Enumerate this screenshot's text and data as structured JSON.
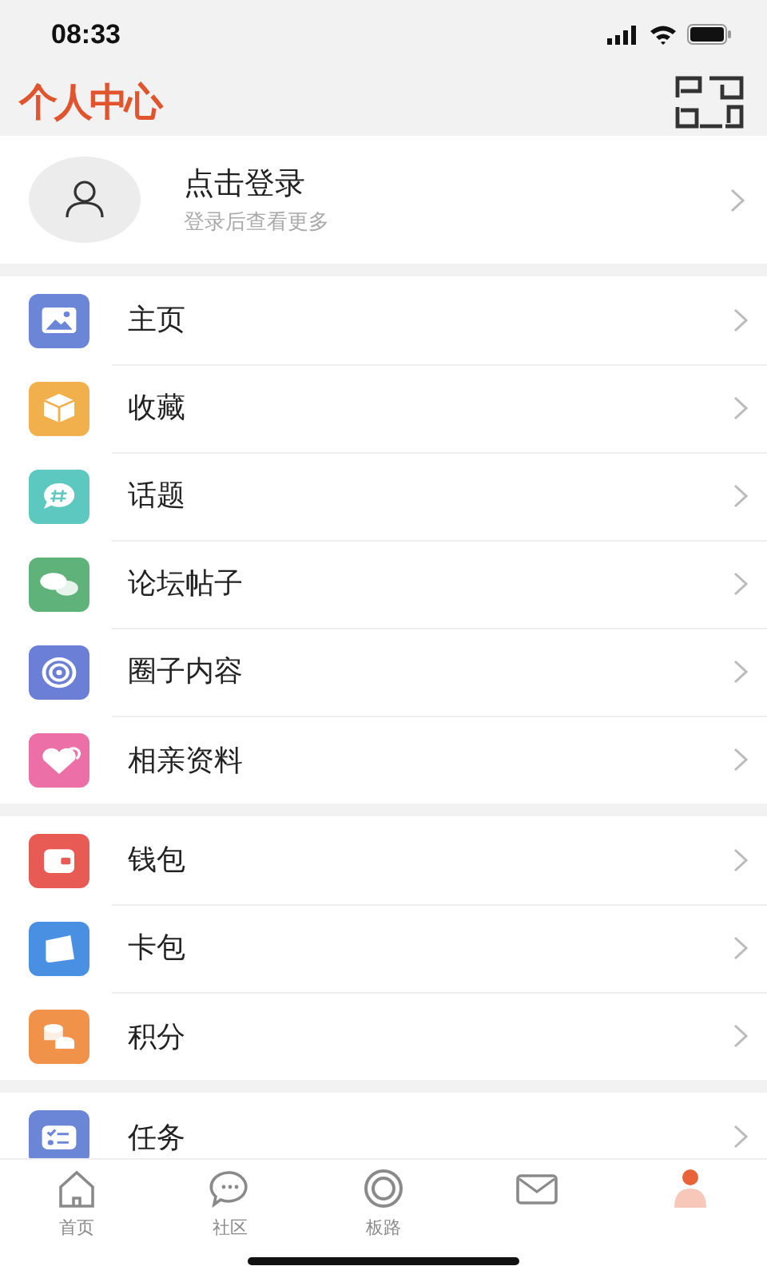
{
  "status_bar": {
    "time": "08:33"
  },
  "header": {
    "title": "个人中心"
  },
  "login": {
    "title": "点击登录",
    "subtitle": "登录后查看更多"
  },
  "sections": [
    {
      "items": [
        {
          "label": "主页",
          "kind": "picture",
          "color": "#6b86d6"
        },
        {
          "label": "收藏",
          "kind": "box",
          "color": "#f2b04d"
        },
        {
          "label": "话题",
          "kind": "topic",
          "color": "#5cc8c0"
        },
        {
          "label": "论坛帖子",
          "kind": "chat",
          "color": "#5fb27a"
        },
        {
          "label": "圈子内容",
          "kind": "spiral",
          "color": "#6b7fd6"
        },
        {
          "label": "相亲资料",
          "kind": "heart",
          "color": "#ec6fa8"
        }
      ]
    },
    {
      "items": [
        {
          "label": "钱包",
          "kind": "wallet",
          "color": "#e85a54"
        },
        {
          "label": "卡包",
          "kind": "card",
          "color": "#4a90e2"
        },
        {
          "label": "积分",
          "kind": "coins",
          "color": "#f0924a"
        }
      ]
    },
    {
      "items": [
        {
          "label": "任务",
          "kind": "tasks",
          "color": "#6b86d6"
        }
      ]
    }
  ],
  "tabs": [
    {
      "label": "首页",
      "kind": "home",
      "selected": false
    },
    {
      "label": "社区",
      "kind": "bubble",
      "selected": false
    },
    {
      "label": "板路",
      "kind": "ring",
      "selected": false
    },
    {
      "kind": "mail",
      "selected": false
    },
    {
      "kind": "person",
      "selected": true
    }
  ]
}
